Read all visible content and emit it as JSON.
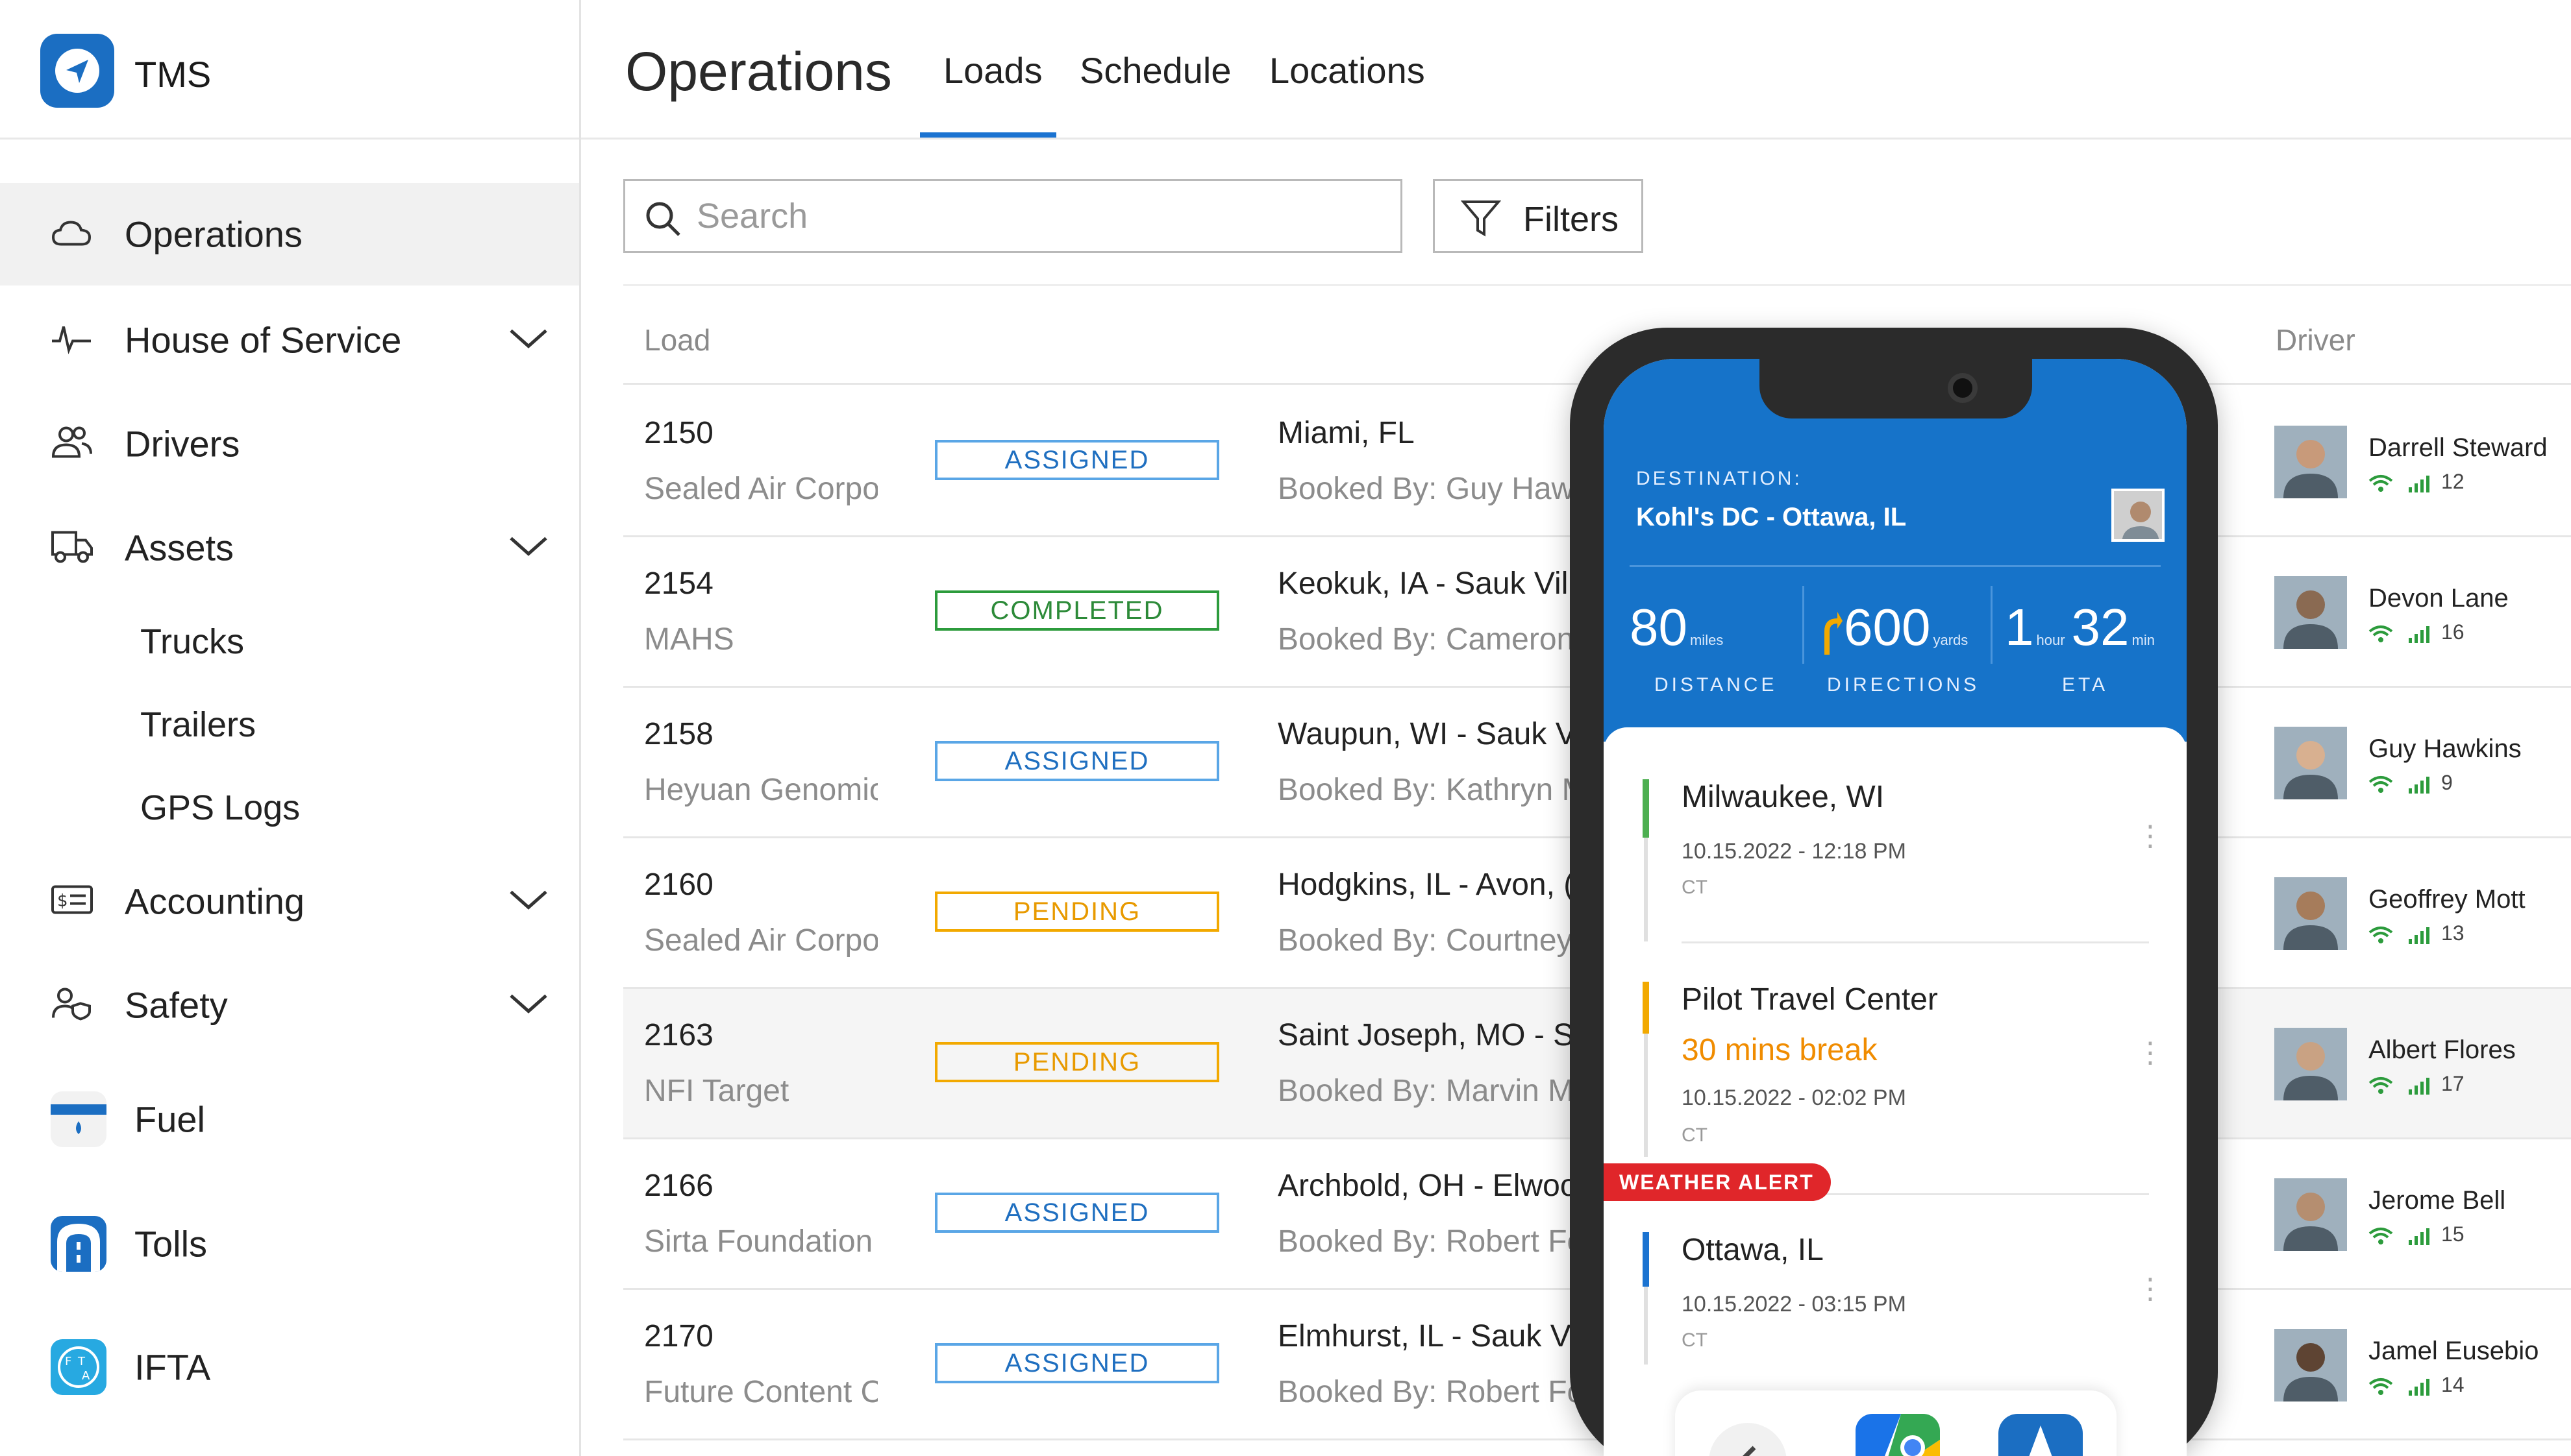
{
  "brand": {
    "name": "TMS"
  },
  "sidebar": {
    "items": [
      {
        "label": "Operations"
      },
      {
        "label": "House of Service"
      },
      {
        "label": "Drivers"
      },
      {
        "label": "Assets"
      },
      {
        "label": "Accounting"
      },
      {
        "label": "Safety"
      }
    ],
    "asset_subitems": [
      "Trucks",
      "Trailers",
      "GPS Logs"
    ],
    "apps": [
      {
        "label": "Fuel",
        "icon": "fuel-icon"
      },
      {
        "label": "Tolls",
        "icon": "tolls-icon"
      },
      {
        "label": "IFTA",
        "icon": "ifta-icon"
      }
    ]
  },
  "header": {
    "title": "Operations",
    "tabs": [
      "Loads",
      "Schedule",
      "Locations"
    ]
  },
  "toolbar": {
    "search_placeholder": "Search",
    "filters_label": "Filters"
  },
  "table": {
    "headers": {
      "load": "Load",
      "driver": "Driver"
    },
    "rows": [
      {
        "id": "2150",
        "company": "Sealed Air Corpora",
        "status": "ASSIGNED",
        "route": "Miami, FL",
        "booked": "Booked By: Guy Hawk",
        "driver": "Darrell Steward",
        "signal": "12"
      },
      {
        "id": "2154",
        "company": "MAHS",
        "status": "COMPLETED",
        "route": "Keokuk, IA - Sauk Vill",
        "booked": "Booked By: Cameron",
        "driver": "Devon Lane",
        "signal": "16"
      },
      {
        "id": "2158",
        "company": "Heyuan Genomics",
        "status": "ASSIGNED",
        "route": "Waupun, WI - Sauk V",
        "booked": "Booked By: Kathryn M",
        "driver": "Guy Hawkins",
        "signal": "9"
      },
      {
        "id": "2160",
        "company": "Sealed Air Corpora",
        "status": "PENDING",
        "route": "Hodgkins, IL - Avon, (",
        "booked": "Booked By: Courtney",
        "driver": "Geoffrey Mott",
        "signal": "13"
      },
      {
        "id": "2163",
        "company": "NFI Target",
        "status": "PENDING",
        "route": "Saint Joseph, MO - Sa",
        "booked": "Booked By: Marvin M",
        "driver": "Albert Flores",
        "signal": "17"
      },
      {
        "id": "2166",
        "company": "Sirta Foundation",
        "status": "ASSIGNED",
        "route": "Archbold, OH - Elwoo",
        "booked": "Booked By: Robert Fo",
        "driver": "Jerome Bell",
        "signal": "15"
      },
      {
        "id": "2170",
        "company": "Future Content Cor",
        "status": "ASSIGNED",
        "route": "Elmhurst, IL - Sauk Vi",
        "booked": "Booked By: Robert Fo",
        "driver": "Jamel Eusebio",
        "signal": "14"
      }
    ]
  },
  "phone": {
    "destination_label": "DESTINATION:",
    "destination": "Kohl's DC - Ottawa, IL",
    "stats": {
      "distance": {
        "value": "80",
        "unit": "miles",
        "label": "DISTANCE"
      },
      "directions": {
        "value": "600",
        "unit": "yards",
        "label": "DIRECTIONS"
      },
      "eta": {
        "hours": "1",
        "hours_unit": "hour",
        "minutes": "32",
        "minutes_unit": "min",
        "label": "ETA"
      }
    },
    "stops": [
      {
        "title": "Milwaukee, WI",
        "time": "10.15.2022  - 12:18 PM",
        "tz": "CT",
        "color": "#4caf50"
      },
      {
        "title": "Pilot Travel Center",
        "note": "30 mins break",
        "time": "10.15.2022  -  02:02 PM",
        "tz": "CT",
        "color": "#f2a900"
      },
      {
        "title": "Ottawa, IL",
        "time": "10.15.2022  - 03:15 PM",
        "tz": "CT",
        "color": "#1b73d1"
      }
    ],
    "weather_alert": "WEATHER ALERT"
  },
  "colors": {
    "accent": "#1b73d1",
    "assigned": "#1f6fc0",
    "completed": "#2c8a38",
    "pending": "#e89a00",
    "alert": "#e0262a"
  }
}
